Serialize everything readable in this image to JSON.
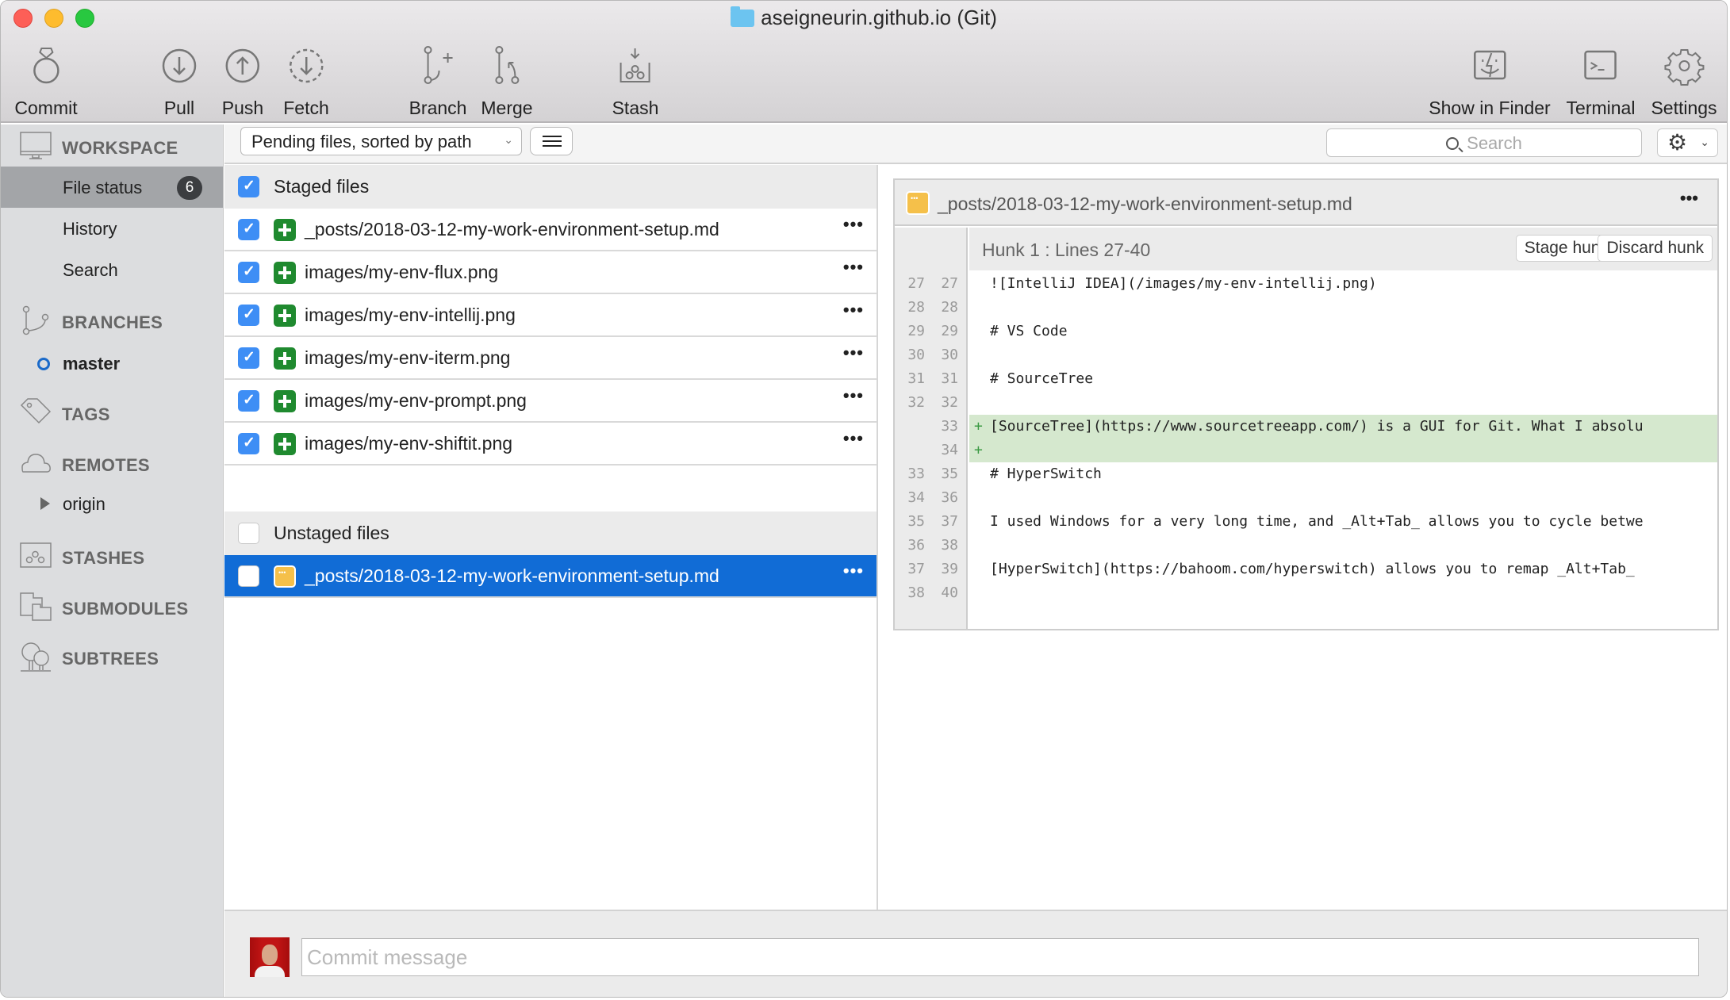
{
  "window": {
    "title": "aseigneurin.github.io (Git)"
  },
  "toolbar": {
    "commit": "Commit",
    "pull": "Pull",
    "push": "Push",
    "fetch": "Fetch",
    "branch": "Branch",
    "merge": "Merge",
    "stash": "Stash",
    "show_in_finder": "Show in Finder",
    "terminal": "Terminal",
    "settings": "Settings"
  },
  "sidebar": {
    "workspace": {
      "label": "WORKSPACE",
      "items": [
        {
          "label": "File status",
          "badge": "6",
          "active": true
        },
        {
          "label": "History"
        },
        {
          "label": "Search"
        }
      ]
    },
    "branches": {
      "label": "BRANCHES",
      "items": [
        {
          "label": "master",
          "current": true
        }
      ]
    },
    "tags": {
      "label": "TAGS"
    },
    "remotes": {
      "label": "REMOTES",
      "items": [
        {
          "label": "origin",
          "collapsed": true
        }
      ]
    },
    "stashes": {
      "label": "STASHES"
    },
    "submodules": {
      "label": "SUBMODULES"
    },
    "subtrees": {
      "label": "SUBTREES"
    }
  },
  "filterbar": {
    "view_mode": "Pending files, sorted by path",
    "search_placeholder": "Search"
  },
  "staged": {
    "label": "Staged files",
    "checked": true,
    "files": [
      {
        "name": "_posts/2018-03-12-my-work-environment-setup.md",
        "status": "added",
        "checked": true
      },
      {
        "name": "images/my-env-flux.png",
        "status": "added",
        "checked": true
      },
      {
        "name": "images/my-env-intellij.png",
        "status": "added",
        "checked": true
      },
      {
        "name": "images/my-env-iterm.png",
        "status": "added",
        "checked": true
      },
      {
        "name": "images/my-env-prompt.png",
        "status": "added",
        "checked": true
      },
      {
        "name": "images/my-env-shiftit.png",
        "status": "added",
        "checked": true
      }
    ]
  },
  "unstaged": {
    "label": "Unstaged files",
    "checked": false,
    "files": [
      {
        "name": "_posts/2018-03-12-my-work-environment-setup.md",
        "status": "modified",
        "checked": false,
        "selected": true
      }
    ]
  },
  "diff": {
    "file": "_posts/2018-03-12-my-work-environment-setup.md",
    "hunk_title": "Hunk 1 : Lines 27-40",
    "stage_hunk": "Stage hunk",
    "discard_hunk": "Discard hunk",
    "lines": [
      {
        "old": "27",
        "new": "27",
        "type": "context",
        "sign": "",
        "text": "![IntelliJ IDEA](/images/my-env-intellij.png)"
      },
      {
        "old": "28",
        "new": "28",
        "type": "context",
        "sign": "",
        "text": ""
      },
      {
        "old": "29",
        "new": "29",
        "type": "context",
        "sign": "",
        "text": "# VS Code"
      },
      {
        "old": "30",
        "new": "30",
        "type": "context",
        "sign": "",
        "text": ""
      },
      {
        "old": "31",
        "new": "31",
        "type": "context",
        "sign": "",
        "text": "# SourceTree"
      },
      {
        "old": "32",
        "new": "32",
        "type": "context",
        "sign": "",
        "text": ""
      },
      {
        "old": "",
        "new": "33",
        "type": "add",
        "sign": "+",
        "text": "[SourceTree](https://www.sourcetreeapp.com/) is a GUI for Git. What I absolu"
      },
      {
        "old": "",
        "new": "34",
        "type": "add",
        "sign": "+",
        "text": ""
      },
      {
        "old": "33",
        "new": "35",
        "type": "context",
        "sign": "",
        "text": "# HyperSwitch"
      },
      {
        "old": "34",
        "new": "36",
        "type": "context",
        "sign": "",
        "text": ""
      },
      {
        "old": "35",
        "new": "37",
        "type": "context",
        "sign": "",
        "text": "I used Windows for a very long time, and _Alt+Tab_ allows you to cycle betwe"
      },
      {
        "old": "36",
        "new": "38",
        "type": "context",
        "sign": "",
        "text": ""
      },
      {
        "old": "37",
        "new": "39",
        "type": "context",
        "sign": "",
        "text": "[HyperSwitch](https://bahoom.com/hyperswitch) allows you to remap _Alt+Tab_"
      },
      {
        "old": "38",
        "new": "40",
        "type": "context",
        "sign": "",
        "text": ""
      }
    ]
  },
  "commit": {
    "placeholder": "Commit message",
    "value": ""
  },
  "colors": {
    "accent": "#116cd6",
    "checkbox": "#3e8ef5",
    "added_badge": "#1f8a2f",
    "modified_badge": "#f5c04a",
    "added_line_bg": "#d5e8ce"
  }
}
